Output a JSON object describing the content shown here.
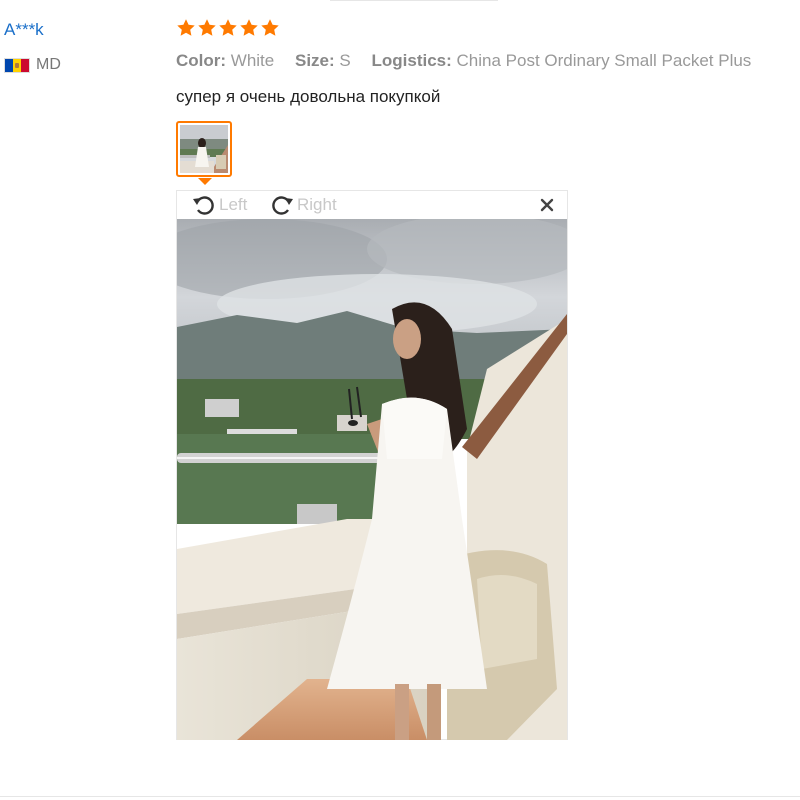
{
  "user": {
    "name": "A***k",
    "country": "MD"
  },
  "review": {
    "rating": 5,
    "color_label": "Color:",
    "color_value": "White",
    "size_label": "Size:",
    "size_value": "S",
    "logistics_label": "Logistics:",
    "logistics_value": "China Post Ordinary Small Packet Plus",
    "text": "супер я очень довольна покупкой"
  },
  "viewer": {
    "rotate_left_label": "Left",
    "rotate_right_label": "Right"
  },
  "colors": {
    "star": "#ff7a00",
    "username": "#1a6fc9",
    "thumb_border": "#ff7a00"
  },
  "icons": [
    "star-icon",
    "rotate-left-icon",
    "rotate-right-icon",
    "close-icon",
    "flag-icon"
  ]
}
